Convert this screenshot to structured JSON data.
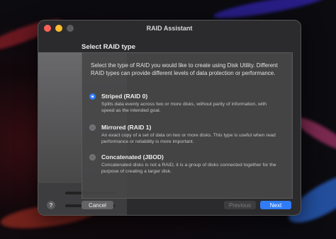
{
  "window": {
    "title": "RAID Assistant"
  },
  "heading": "Select RAID type",
  "intro": "Select the type of RAID you would like to create using Disk Utility. Different RAID types can provide different levels of data protection or performance.",
  "options": [
    {
      "title": "Striped (RAID 0)",
      "desc": "Splits data evenly across two or more disks, without parity of information, with speed as the intended goal.",
      "selected": true
    },
    {
      "title": "Mirrored (RAID 1)",
      "desc": "An exact copy of a set of data on two or more disks. This type is useful when read performance or reliability is more important.",
      "selected": false
    },
    {
      "title": "Concatenated (JBOD)",
      "desc": "Concatenated disks is not a RAID, it is a group of disks connected together for the purpose of creating a larger disk.",
      "selected": false
    }
  ],
  "buttons": {
    "help": "?",
    "cancel": "Cancel",
    "previous": "Previous",
    "next": "Next"
  },
  "colors": {
    "accent": "#2f7cf6",
    "window_bg": "#2b2b2d",
    "close": "#fe5f57",
    "minimize": "#febc2e"
  }
}
